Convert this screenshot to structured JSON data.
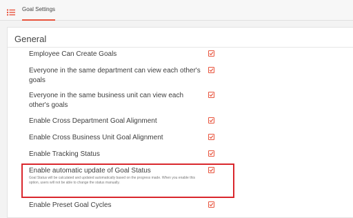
{
  "header": {
    "tab_label": "Goal Settings",
    "menu_icon": "list-menu-icon",
    "accent_color": "#e8533c"
  },
  "general": {
    "title": "General",
    "settings": [
      {
        "label": "Employee Can Create Goals",
        "checked": true
      },
      {
        "label": "Everyone in the same department can view each other's goals",
        "checked": true
      },
      {
        "label": "Everyone in the same business unit can view each other's goals",
        "checked": true
      },
      {
        "label": "Enable Cross Department Goal Alignment",
        "checked": true
      },
      {
        "label": "Enable Cross Business Unit Goal Alignment",
        "checked": true
      },
      {
        "label": "Enable Tracking Status",
        "checked": true
      },
      {
        "label": "Enable automatic update of Goal Status",
        "checked": true,
        "description": "Goal Status will be calculated and updated automatically based on the progress made. When you enable this option, users will not be able to change the status manually."
      },
      {
        "label": "Enable Preset Goal Cycles",
        "checked": true
      }
    ]
  },
  "highlight_color": "#d9262c"
}
